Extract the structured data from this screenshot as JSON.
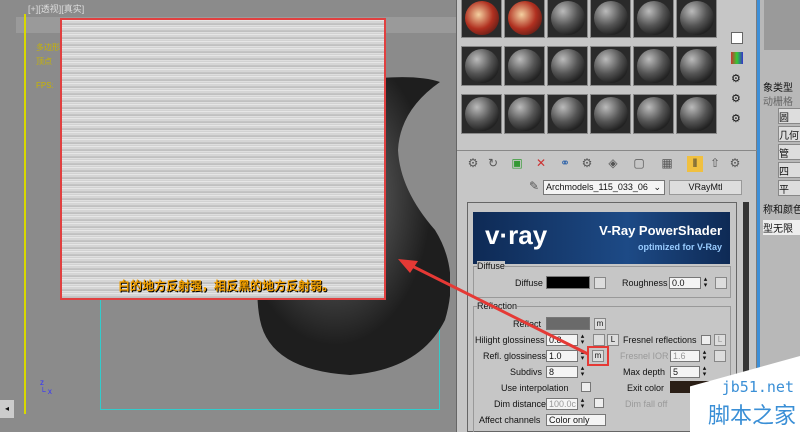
{
  "viewport": {
    "label": "[+][透视][真实]",
    "stats1": "多边形",
    "stats2": "顶点",
    "fps": "FPS:",
    "caption": "白的地方反射强，相反黑的地方反射弱。"
  },
  "material_editor": {
    "material_name": "Archmodels_115_033_06",
    "material_type": "VRayMtl",
    "banner": {
      "logo": "v·ray",
      "title": "V-Ray PowerShader",
      "subtitle": "optimized for V-Ray"
    },
    "diffuse": {
      "group": "Diffuse",
      "diffuse_label": "Diffuse",
      "roughness_label": "Roughness",
      "roughness": "0.0"
    },
    "reflection": {
      "group": "Reflection",
      "reflect_label": "Reflect",
      "map_btn": "m",
      "hilight_label": "Hilight glossiness",
      "hilight": "0.8",
      "lock": "L",
      "fresnel_label": "Fresnel reflections",
      "refl_gloss_label": "Refl. glossiness",
      "refl_gloss": "1.0",
      "fresnel_ior_label": "Fresnel IOR",
      "fresnel_ior": "1.6",
      "subdivs_label": "Subdivs",
      "subdivs": "8",
      "max_depth_label": "Max depth",
      "max_depth": "5",
      "interp_label": "Use interpolation",
      "exit_label": "Exit color",
      "dim_dist_label": "Dim distance",
      "dim_dist": "100.0c",
      "dim_falloff_label": "Dim fall off",
      "affect_label": "Affect channels",
      "affect": "Color only"
    },
    "colors": {
      "diffuse": "#000000",
      "reflect": "#6a6a6a",
      "highlight": "#e53935"
    }
  },
  "command_panel": {
    "object_type": "象类型",
    "autogrid": "动栅格",
    "buttons": [
      "圆",
      "几何",
      "管",
      "四",
      "平"
    ],
    "name_color": "称和颜色",
    "infinite": "型无限"
  },
  "watermark": {
    "site": "jb51.net",
    "name": "脚本之家"
  }
}
